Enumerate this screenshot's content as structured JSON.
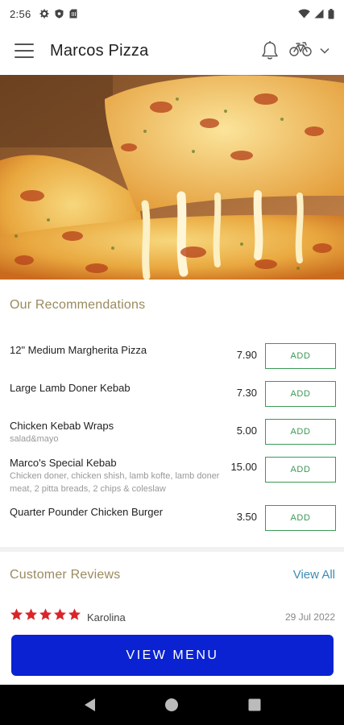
{
  "status_bar": {
    "time": "2:56",
    "left_icons": [
      "gear-icon",
      "shield-icon",
      "sim-card-icon"
    ],
    "right_icons": [
      "wifi-icon",
      "cellular-signal-icon",
      "battery-icon"
    ]
  },
  "app_bar": {
    "title": "Marcos Pizza",
    "actions": [
      "bell-icon",
      "bicycle-icon",
      "chevron-down-icon"
    ]
  },
  "hero": {
    "image": "pizza-cheese-pull-photo"
  },
  "recommendations": {
    "title": "Our Recommendations",
    "add_label": "ADD",
    "items": [
      {
        "name": "12\" Medium Margherita Pizza",
        "description": "",
        "price": "7.90"
      },
      {
        "name": "Large Lamb Doner Kebab",
        "description": "",
        "price": "7.30"
      },
      {
        "name": "Chicken Kebab Wraps",
        "description": "salad&mayo",
        "price": "5.00"
      },
      {
        "name": "Marco's Special Kebab",
        "description": "Chicken doner, chicken shish, lamb kofte, lamb doner meat, 2 pitta breads, 2 chips & coleslaw",
        "price": "15.00"
      },
      {
        "name": "Quarter Pounder Chicken Burger",
        "description": "",
        "price": "3.50"
      }
    ]
  },
  "reviews": {
    "title": "Customer Reviews",
    "view_all": "View All",
    "items": [
      {
        "rating": 5,
        "reviewer": "Karolina",
        "date": "29 Jul 2022"
      }
    ]
  },
  "view_menu_label": "VIEW MENU",
  "colors": {
    "accent_gold": "#9a8a5e",
    "add_green": "#3c9a55",
    "link_blue": "#3d8bb5",
    "cta_blue": "#0a22d2",
    "star_red": "#d9252a"
  },
  "nav_bar": {
    "buttons": [
      "back-icon",
      "home-icon",
      "recents-icon"
    ]
  }
}
